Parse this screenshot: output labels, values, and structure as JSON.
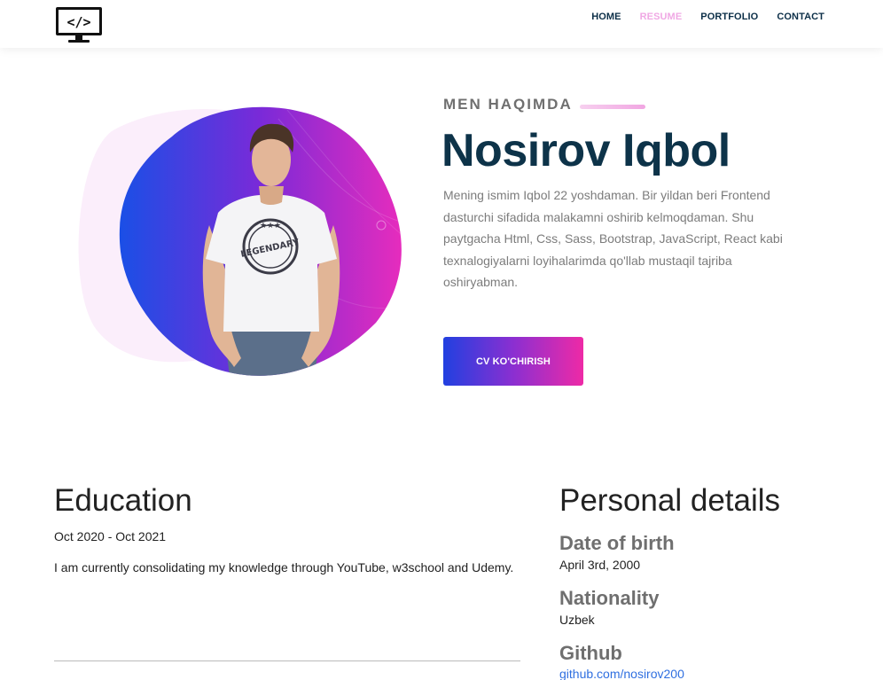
{
  "header": {
    "logo_icon": "code-monitor-icon",
    "nav": [
      {
        "label": "HOME",
        "active": false
      },
      {
        "label": "RESUME",
        "active": true
      },
      {
        "label": "PORTFOLIO",
        "active": false
      },
      {
        "label": "CONTACT",
        "active": false
      }
    ]
  },
  "hero": {
    "eyebrow": "MEN HAQIMDA",
    "name": "Nosirov Iqbol",
    "description": "Mening ismim Iqbol 22 yoshdaman. Bir yildan beri Frontend dasturchi sifadida malakamni oshirib kelmoqdaman. Shu paytgacha Html, Css, Sass, Bootstrap, JavaScript, React kabi texnalogiyalarni loyihalarimda qo'llab mustaqil tajriba oshiryabman.",
    "cv_button": "CV KO'CHIRISH",
    "photo_shirt_text": "LEGENDARY"
  },
  "education": {
    "title": "Education",
    "dates": "Oct 2020 - Oct 2021",
    "description": "I am currently consolidating my knowledge through YouTube, w3school and Udemy."
  },
  "personal": {
    "title": "Personal details",
    "items": [
      {
        "label": "Date of birth",
        "value": "April 3rd, 2000"
      },
      {
        "label": "Nationality",
        "value": "Uzbek"
      },
      {
        "label": "Github",
        "value": "github.com/nosirov200"
      }
    ]
  },
  "colors": {
    "navy": "#0c2f48",
    "active_pink": "#f0a8e4",
    "gradient_blue": "#2140e0",
    "gradient_pink": "#ee2aa6",
    "link": "#2f6fe0"
  }
}
